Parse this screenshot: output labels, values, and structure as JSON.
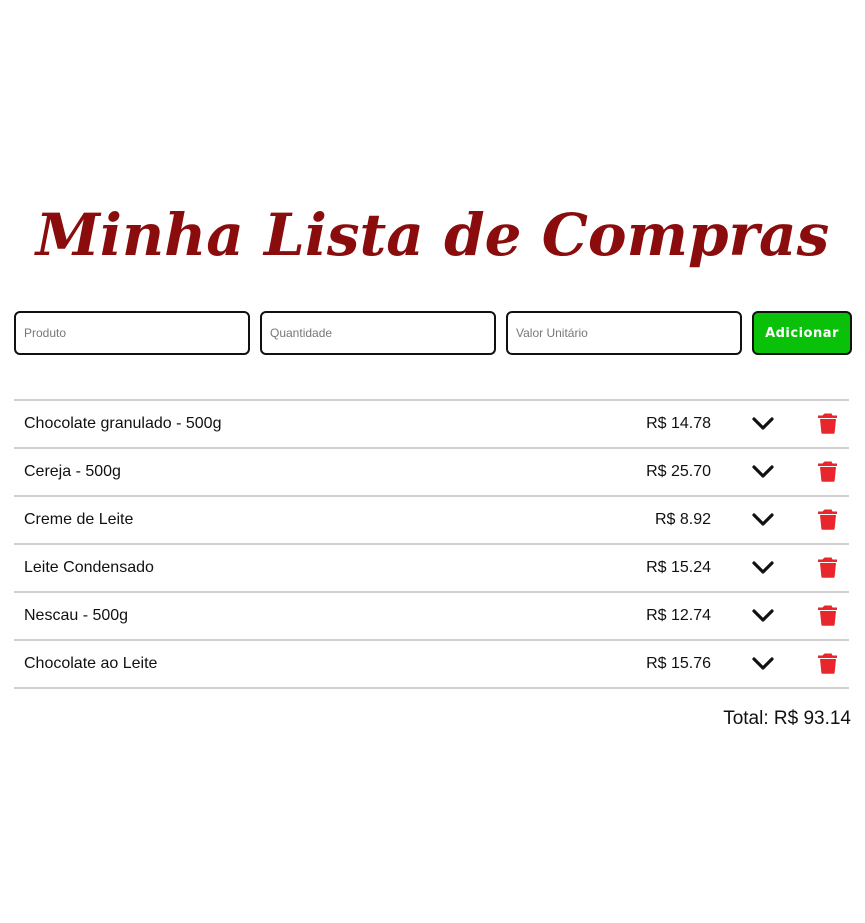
{
  "header": {
    "title": "Minha Lista de Compras"
  },
  "form": {
    "product_placeholder": "Produto",
    "quantity_placeholder": "Quantidade",
    "unit_value_placeholder": "Valor Unitário",
    "add_label": "Adicionar"
  },
  "items": [
    {
      "name": "Chocolate granulado - 500g",
      "price": "R$ 14.78"
    },
    {
      "name": "Cereja - 500g",
      "price": "R$ 25.70"
    },
    {
      "name": "Creme de Leite",
      "price": "R$ 8.92"
    },
    {
      "name": "Leite Condensado",
      "price": "R$ 15.24"
    },
    {
      "name": "Nescau - 500g",
      "price": "R$ 12.74"
    },
    {
      "name": "Chocolate ao Leite",
      "price": "R$ 15.76"
    }
  ],
  "summary": {
    "total": "Total: R$ 93.14"
  },
  "icons": {
    "expand": "chevron-down-icon",
    "delete": "trash-icon"
  },
  "colors": {
    "title": "#8a0c0c",
    "add_button": "#0ac10a",
    "delete_icon": "#e8262b"
  }
}
